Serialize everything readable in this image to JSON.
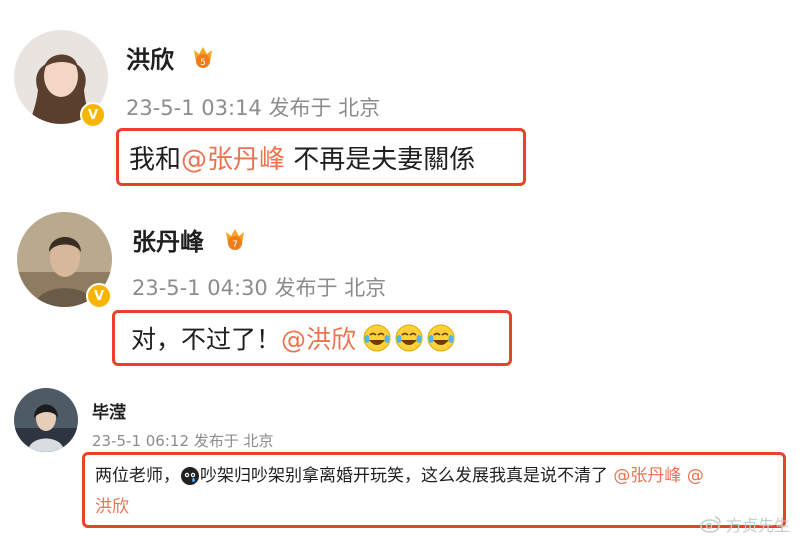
{
  "posts": [
    {
      "author": "洪欣",
      "time": "23-5-1 03:14",
      "location": "发布于 北京",
      "level_badge": "5",
      "content_text": "我和",
      "content_mention": "@张丹峰",
      "content_after": " 不再是夫妻關係"
    },
    {
      "author": "张丹峰",
      "time": "23-5-1 04:30",
      "location": "发布于 北京",
      "level_badge": "7",
      "content_text": "对，不过了！",
      "content_mention": "@洪欣",
      "emoji": "laughing-crying-emoji"
    },
    {
      "author": "毕滢",
      "time": "23-5-1 06:12",
      "location": "发布于 北京",
      "content_part1": "两位老师，",
      "content_part2": "吵架归吵架别拿离婚开玩笑，这么发展我真是说不清了",
      "content_mention1": "@张丹峰",
      "content_mention2": "@",
      "content_mention2_cont": "洪欣",
      "emoji": "black-cat-emoji"
    }
  ],
  "verified_icon": "V",
  "watermark": "方贞先生"
}
